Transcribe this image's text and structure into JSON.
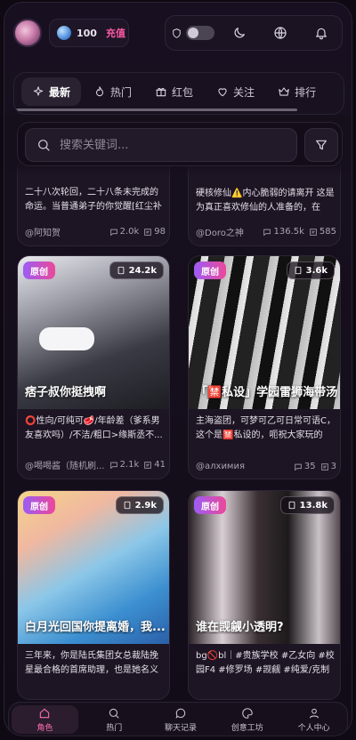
{
  "header": {
    "coins": "100",
    "recharge_label": "充值"
  },
  "tabs": [
    {
      "label": "最新",
      "icon": "sparkle-icon",
      "active": true
    },
    {
      "label": "热门",
      "icon": "flame-icon"
    },
    {
      "label": "红包",
      "icon": "gift-icon"
    },
    {
      "label": "关注",
      "icon": "heart-icon"
    },
    {
      "label": "排行",
      "icon": "crown-icon"
    }
  ],
  "search": {
    "placeholder": "搜索关键词..."
  },
  "cards": [
    {
      "desc": "二十八次轮回，二十八条未完成的命运。当普通弟子的你觉醒[红尘补全...",
      "author": "@阿知贺",
      "comments": "2.0k",
      "chats": "98"
    },
    {
      "desc": "硬核修仙⚠️内心脆弱的请离开 这是为真正喜欢修仙的人准备的，在这...",
      "author": "@Doro之神",
      "comments": "136.5k",
      "chats": "585"
    },
    {
      "badge": "原创",
      "count": "24.2k",
      "title": "痞子叔你挺拽啊",
      "desc": "⭕性向/可纯可🥩/年龄差（爹系男友喜欢吗）/不洁/粗口>缘斯丞不...",
      "author": "@喝喝酱（随机刷...",
      "comments": "2.1k",
      "chats": "41"
    },
    {
      "badge": "原创",
      "count": "3.6k",
      "title": "「🈲私设」学园雷狮海带汤",
      "desc": "主海盗团，可梦可乙可日常可语C，这个是🈲私设的，呃祝大家玩的开...",
      "author": "@алхимия",
      "comments": "35",
      "chats": "3"
    },
    {
      "badge": "原创",
      "count": "2.9k",
      "title": "白月光回国你提离婚，我...",
      "desc": "三年来，你是陆氏集团女总裁陆挽星最合格的首席助理，也是她名义上...",
      "author": "",
      "comments": "",
      "chats": ""
    },
    {
      "badge": "原创",
      "count": "13.8k",
      "title": "谁在觊觎小透明?",
      "desc": "bg🚫bl｜#贵族学校 #乙女向 #校园F4 #修罗场 #觊觎 #纯爱/克制｜use...",
      "author": "",
      "comments": "",
      "chats": ""
    }
  ],
  "nav": [
    {
      "label": "角色",
      "active": true
    },
    {
      "label": "热门"
    },
    {
      "label": "聊天记录"
    },
    {
      "label": "创意工坊"
    },
    {
      "label": "个人中心"
    }
  ]
}
